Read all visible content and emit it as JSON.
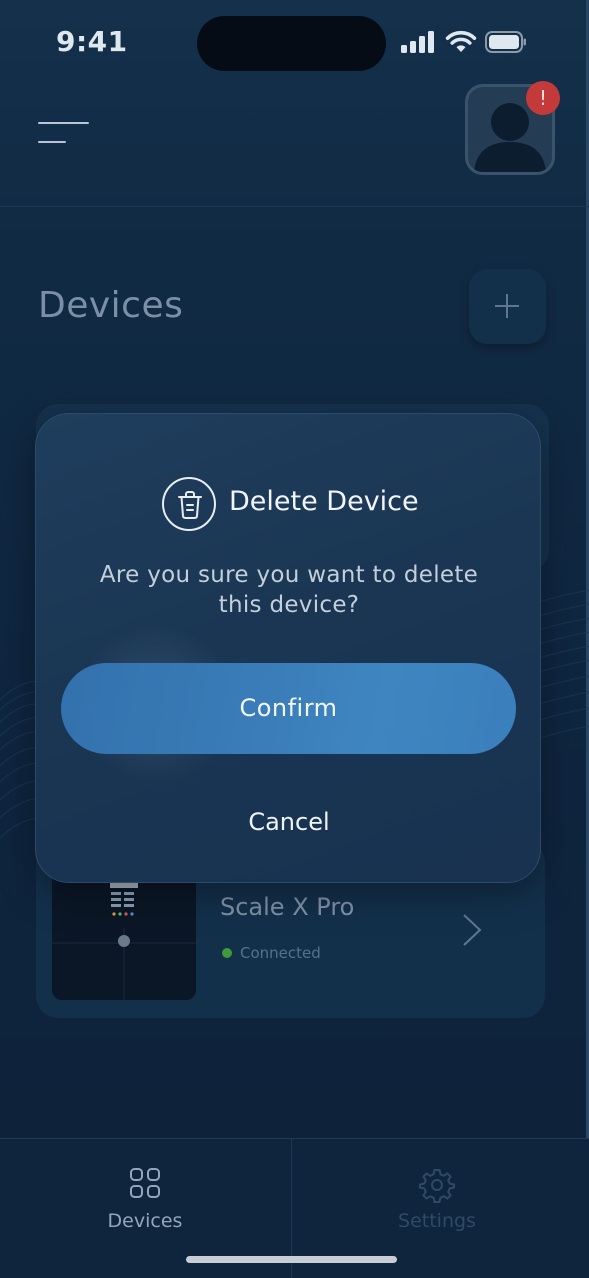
{
  "status_bar": {
    "time": "9:41"
  },
  "header": {
    "menu_icon": "hamburger-icon",
    "avatar_icon": "user-avatar-icon",
    "alert_badge": "!"
  },
  "page": {
    "title": "Devices",
    "add_icon": "plus-icon"
  },
  "device": {
    "name": "Scale X Pro",
    "status": "Connected",
    "status_color": "#3f9a3a"
  },
  "modal": {
    "icon": "trash-icon",
    "title": "Delete Device",
    "message": "Are you sure you want to delete this device?",
    "confirm_label": "Confirm",
    "cancel_label": "Cancel",
    "accent": "#3a7db8"
  },
  "tabs": [
    {
      "label": "Devices",
      "icon": "grid-icon",
      "active": true
    },
    {
      "label": "Settings",
      "icon": "gear-icon",
      "active": false
    }
  ]
}
